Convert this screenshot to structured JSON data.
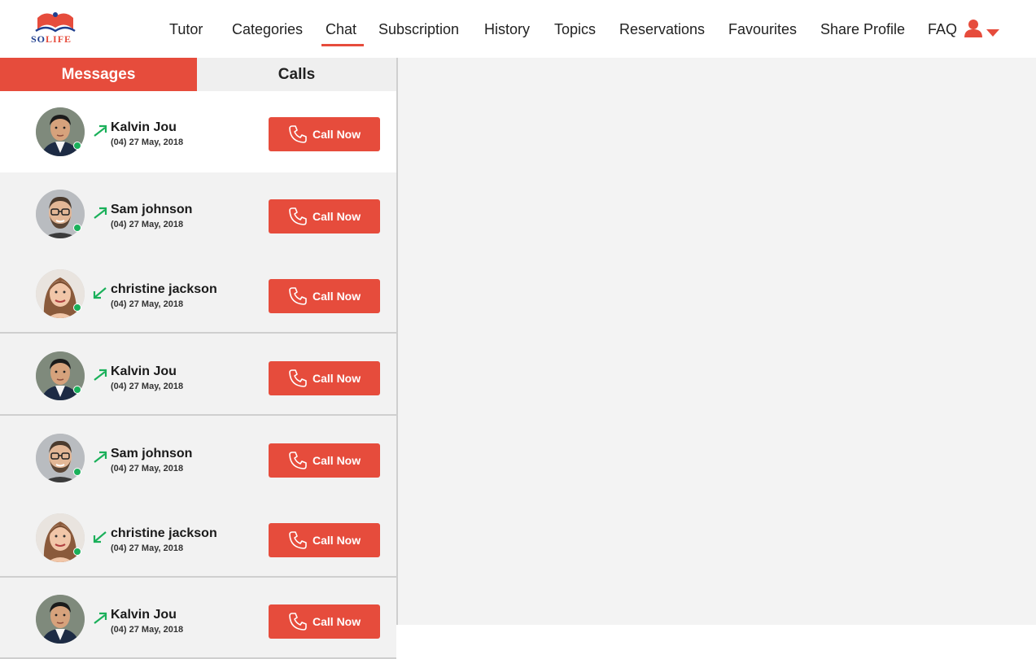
{
  "brand": {
    "logo_prefix": "SO",
    "logo_suffix": "LIFE"
  },
  "nav": {
    "items": [
      "Tutor",
      "Categories",
      "Chat",
      "Subscription",
      "History",
      "Topics",
      "Reservations",
      "Favourites",
      "Share Profile",
      "FAQ"
    ],
    "active": "Chat"
  },
  "tabs": {
    "messages": "Messages",
    "calls": "Calls",
    "active": "Messages"
  },
  "call_button_label": "Call Now",
  "calls": [
    {
      "name": "Kalvin Jou",
      "date": "(04) 27 May, 2018",
      "direction": "outgoing",
      "avatar": "man-asian",
      "online": true
    },
    {
      "name": "Sam johnson",
      "date": "(04) 27 May, 2018",
      "direction": "outgoing",
      "avatar": "man-glasses",
      "online": true
    },
    {
      "name": "christine jackson",
      "date": "(04) 27 May, 2018",
      "direction": "incoming",
      "avatar": "woman",
      "online": true
    },
    {
      "name": "Kalvin Jou",
      "date": "(04) 27 May, 2018",
      "direction": "outgoing",
      "avatar": "man-asian",
      "online": true
    },
    {
      "name": "Sam johnson",
      "date": "(04) 27 May, 2018",
      "direction": "outgoing",
      "avatar": "man-glasses",
      "online": true
    },
    {
      "name": "christine jackson",
      "date": "(04) 27 May, 2018",
      "direction": "incoming",
      "avatar": "woman",
      "online": true
    },
    {
      "name": "Kalvin Jou",
      "date": "(04) 27 May, 2018",
      "direction": "outgoing",
      "avatar": "man-asian",
      "online": false
    }
  ],
  "colors": {
    "accent": "#e64c3c",
    "online": "#1ab05a",
    "direction_arrow": "#1ab05a",
    "logo_blue": "#1f3f8f"
  },
  "icons": {
    "user_menu": "user-icon",
    "dropdown": "caret-down-icon",
    "call": "phone-icon"
  }
}
